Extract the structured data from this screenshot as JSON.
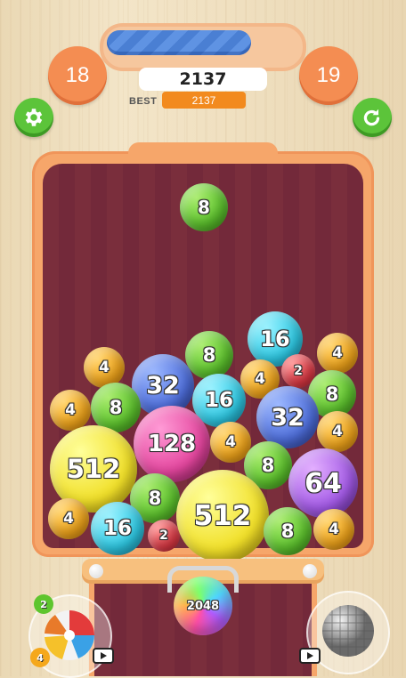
{
  "hud": {
    "current_level": "18",
    "next_level": "19",
    "score": "2137",
    "best_label": "BEST",
    "best_score": "2137",
    "level_progress": 0.75
  },
  "colors": {
    "board": "#7a2e3c",
    "frame": "#f6a66a",
    "progress_fill": "#4a7fd3",
    "button_green": "#5cc43a",
    "best_orange": "#f28a1e"
  },
  "drop_ball": {
    "value": "8"
  },
  "balls": [
    {
      "value": "16"
    },
    {
      "value": "8"
    },
    {
      "value": "4"
    },
    {
      "value": "4"
    },
    {
      "value": "32"
    },
    {
      "value": "2"
    },
    {
      "value": "4"
    },
    {
      "value": "16"
    },
    {
      "value": "8"
    },
    {
      "value": "4"
    },
    {
      "value": "8"
    },
    {
      "value": "32"
    },
    {
      "value": "4"
    },
    {
      "value": "512"
    },
    {
      "value": "128"
    },
    {
      "value": "4"
    },
    {
      "value": "8"
    },
    {
      "value": "64"
    },
    {
      "value": "8"
    },
    {
      "value": "4"
    },
    {
      "value": "16"
    },
    {
      "value": "2"
    },
    {
      "value": "512"
    },
    {
      "value": "8"
    },
    {
      "value": "4"
    }
  ],
  "next_ball": {
    "value": "2048"
  },
  "powerups": {
    "left": {
      "icon": "beach-ball-icon",
      "badge_top": "2",
      "badge_bottom": "4"
    },
    "right": {
      "icon": "disco-ball-icon"
    }
  }
}
